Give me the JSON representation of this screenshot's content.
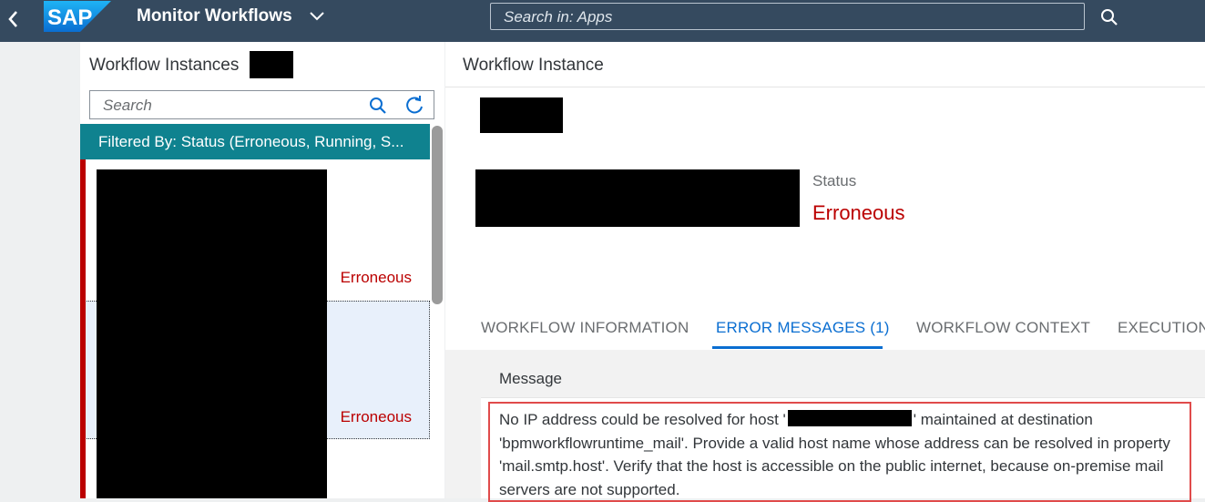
{
  "shell": {
    "logo": "SAP",
    "app_title": "Monitor Workflows",
    "search_placeholder": "Search in: Apps"
  },
  "list": {
    "title": "Workflow Instances",
    "search_placeholder": "Search",
    "filter_text": "Filtered By: Status (Erroneous, Running, S...",
    "items": [
      {
        "status": "Erroneous"
      },
      {
        "status": "Erroneous"
      }
    ]
  },
  "detail": {
    "header_title": "Workflow Instance",
    "status_label": "Status",
    "status_value": "Erroneous",
    "tabs": [
      {
        "label": "WORKFLOW INFORMATION"
      },
      {
        "label": "ERROR MESSAGES (1)"
      },
      {
        "label": "WORKFLOW CONTEXT"
      },
      {
        "label": "EXECUTION"
      }
    ],
    "messages": {
      "column_header": "Message",
      "text_part1": "No IP address could be resolved for host '",
      "text_part2": "' maintained at destination 'bpmworkflowruntime_mail'. Provide a valid host name whose address can be resolved in property 'mail.smtp.host'. Verify that the host is accessible on the public internet, because on-premise mail servers are not supported."
    }
  },
  "colors": {
    "shell": "#354a5f",
    "filter_bar": "#0f828f",
    "error": "#bb0000",
    "active_tab": "#0a6ed1",
    "highlight_box": "#e04b4b"
  }
}
